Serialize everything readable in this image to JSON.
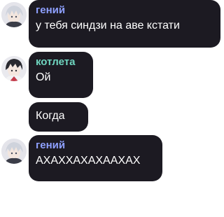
{
  "colors": {
    "bubble_bg": "#1c1a22",
    "message_text": "#ffffff",
    "sender_genius": "#8ea0ff",
    "sender_kotleta": "#6fd6c0"
  },
  "messages": [
    {
      "sender": "гений",
      "text": "у тебя синдзи на аве кстати",
      "avatar_icon": "white-haired-anime-avatar-icon"
    },
    {
      "sender": "котлета",
      "text": "Ой",
      "avatar_icon": "dark-haired-anime-avatar-icon"
    },
    {
      "text": "Когда"
    },
    {
      "sender": "гений",
      "text": "АХАХХАХАХААХАХ",
      "avatar_icon": "white-haired-anime-avatar-icon"
    }
  ]
}
